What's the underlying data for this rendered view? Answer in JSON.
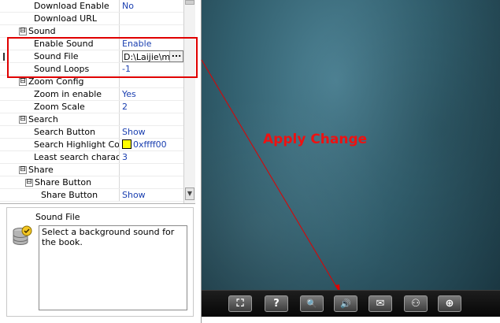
{
  "properties": {
    "rows": [
      {
        "name": "Download Enable",
        "value": "No"
      },
      {
        "name": "Download URL",
        "value": ""
      },
      {
        "name": "Sound",
        "category": true
      },
      {
        "name": "Enable Sound",
        "value": "Enable"
      },
      {
        "name": "Sound File",
        "value": "D:\\Laijie\\mus"
      },
      {
        "name": "Sound Loops",
        "value": "-1"
      },
      {
        "name": "Zoom Config",
        "category": true
      },
      {
        "name": "Zoom in enable",
        "value": "Yes"
      },
      {
        "name": "Zoom Scale",
        "value": "2"
      },
      {
        "name": "Search",
        "category": true
      },
      {
        "name": "Search Button",
        "value": "Show"
      },
      {
        "name": "Search Highlight Color",
        "value": "0xffff00"
      },
      {
        "name": "Least search charac...",
        "value": "3"
      },
      {
        "name": "Share",
        "category": true
      },
      {
        "name": "Share Button",
        "category": true
      },
      {
        "name": "Share Button",
        "value": "Show"
      }
    ],
    "expander_glyph": "⊟",
    "ellipsis_label": "..."
  },
  "description": {
    "title": "Sound File",
    "text": "Select a background sound for the book.",
    "icon": "database-check-icon"
  },
  "annotation": {
    "label": "Apply Change",
    "color": "#ee1111"
  },
  "toolbar": {
    "buttons": [
      {
        "icon": "fit-screen-icon",
        "glyph": "⛶"
      },
      {
        "icon": "help-icon",
        "glyph": "?"
      },
      {
        "icon": "search-icon",
        "glyph": "🔍"
      },
      {
        "icon": "sound-icon",
        "glyph": "🔊"
      },
      {
        "icon": "email-icon",
        "glyph": "✉"
      },
      {
        "icon": "share-icon",
        "glyph": "⚇"
      },
      {
        "icon": "zoom-in-icon",
        "glyph": "⊕"
      }
    ]
  },
  "colors": {
    "value_text": "#1a3fb0",
    "highlight_swatch": "#ffff00",
    "annotation_red": "#e00000"
  }
}
